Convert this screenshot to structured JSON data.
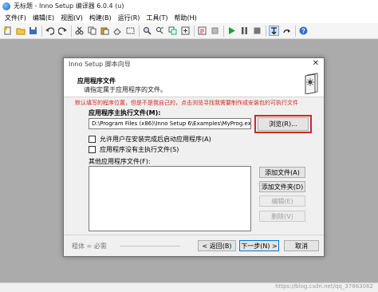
{
  "window": {
    "title": "无标题 - Inno Setup 编译器 6.0.4 (u)"
  },
  "menu": [
    "文件(F)",
    "编辑(E)",
    "视图(V)",
    "构建(B)",
    "运行(R)",
    "工具(T)",
    "帮助(H)"
  ],
  "toolbar": {
    "icons": [
      "new-file-icon",
      "open-icon",
      "save-icon",
      "undo-icon",
      "redo-icon",
      "cut-icon",
      "copy-icon",
      "paste-icon",
      "delete-icon",
      "select-all-icon",
      "find-icon",
      "find-next-icon",
      "replace-icon",
      "compile-icon",
      "stop-compile-icon",
      "run-icon",
      "pause-icon",
      "stop-icon",
      "step-into-icon",
      "step-over-icon",
      "help-icon"
    ]
  },
  "dialog": {
    "title": "Inno Setup 脚本向导",
    "close_glyph": "✕",
    "header_title": "应用程序文件",
    "header_subtitle": "请指定属于应用程序的文件。",
    "note": "默认填写的程序位置，但是不是我自己的，点击浏览寻找我需要制作成安装包的可执行文件",
    "exe_label": "应用程序主执行文件(M):",
    "exe_value": "D:\\Program Files (x86)\\Inno Setup 6\\Examples\\MyProg.exe",
    "browse_label": "浏览(R)...",
    "check_launch": "允许用户在安装完成后启动应用程序(A)",
    "check_no_exe": "应用程序没有主执行文件(S)",
    "other_label": "其他应用程序文件(F):",
    "add_files": "添加文件(A)",
    "add_folder": "添加文件夹(D)",
    "edit": "编辑(E)",
    "remove": "删除(V)",
    "footer_bold": "粗体 = 必需",
    "back": "< 返回(B)",
    "next": "下一步(N) >",
    "cancel": "取消"
  },
  "status": {
    "watermark": "https://blog.csdn.net/qq_37863062"
  },
  "colors": {
    "note_red": "#d6261d",
    "highlight_red": "#d42424",
    "default_button_blue": "#0078d7"
  }
}
